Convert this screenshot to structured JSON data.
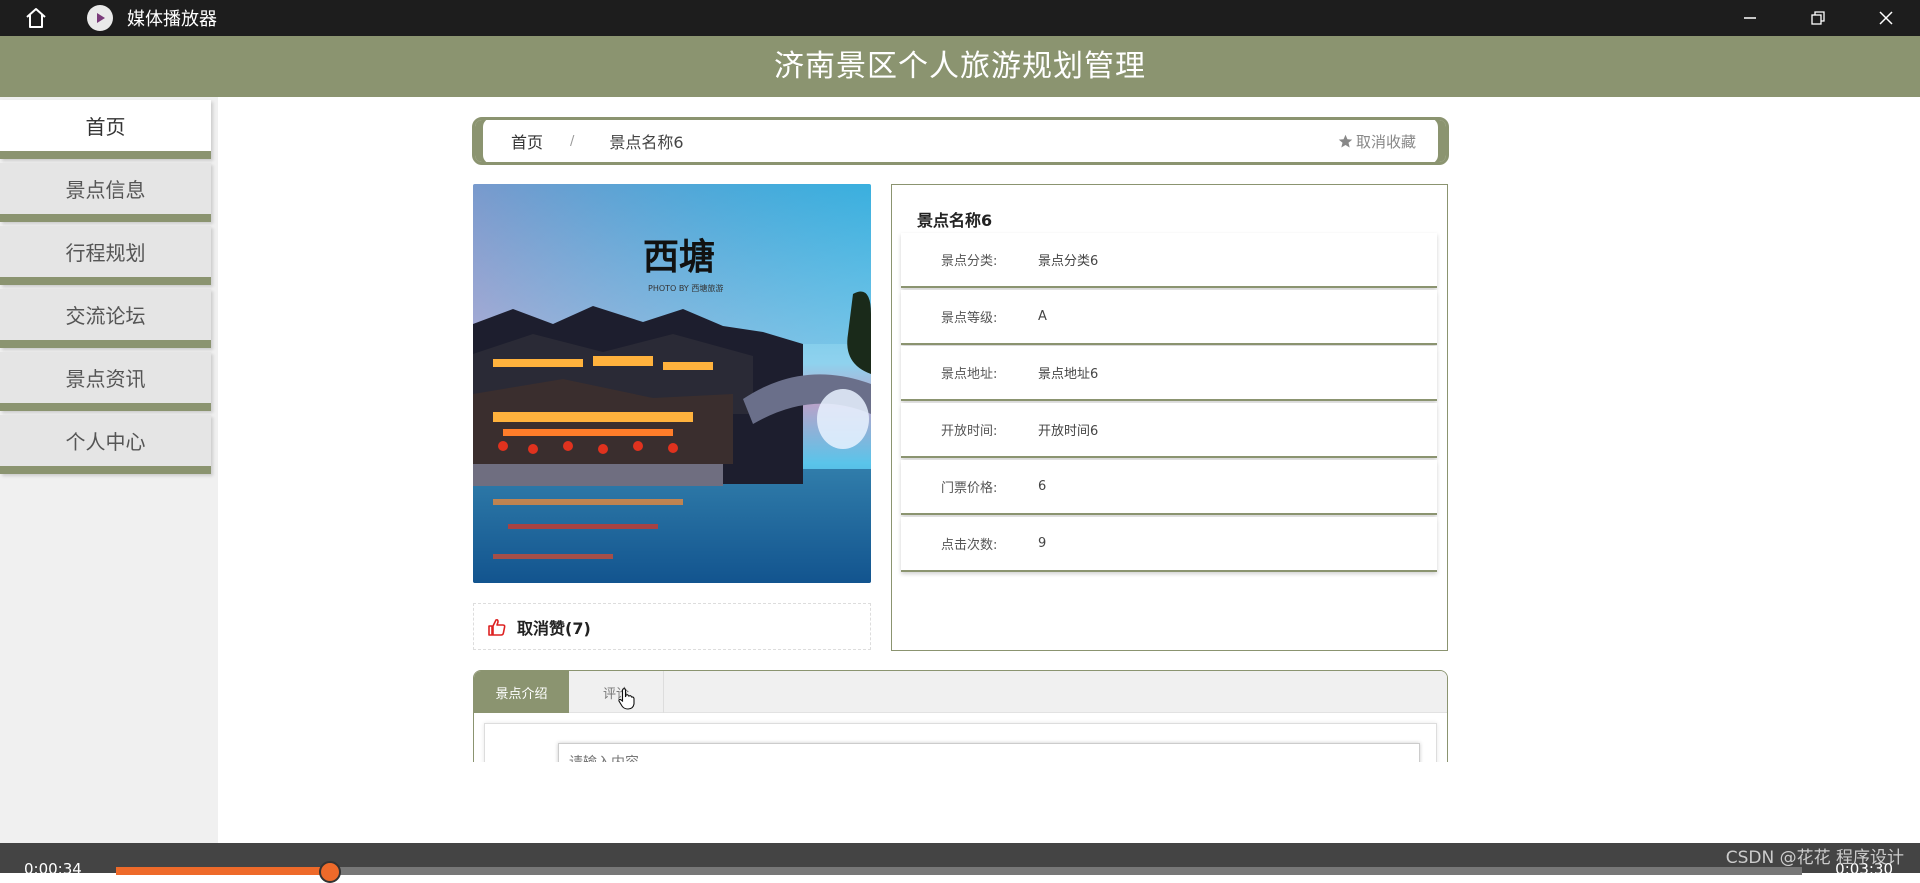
{
  "player": {
    "title": "媒体播放器",
    "current_time": "0:00:34",
    "total_time": "0:03:30",
    "progress": 0.127,
    "watermark": "CSDN @花花 程序设计"
  },
  "site": {
    "title": "济南景区个人旅游规划管理"
  },
  "sidebar": {
    "items": [
      {
        "label": "首页"
      },
      {
        "label": "景点信息"
      },
      {
        "label": "行程规划"
      },
      {
        "label": "交流论坛"
      },
      {
        "label": "景点资讯"
      },
      {
        "label": "个人中心"
      }
    ]
  },
  "breadcrumb": {
    "home": "首页",
    "separator": "/",
    "current": "景点名称6",
    "favorite": "取消收藏"
  },
  "image": {
    "caption_line1": "西塘",
    "caption_line2": "PHOTO BY 西塘旅游"
  },
  "like": {
    "label": "取消赞(7)"
  },
  "info": {
    "title": "景点名称6",
    "rows": [
      {
        "label": "景点分类:",
        "value": "景点分类6"
      },
      {
        "label": "景点等级:",
        "value": "A"
      },
      {
        "label": "景点地址:",
        "value": "景点地址6"
      },
      {
        "label": "开放时间:",
        "value": "开放时间6"
      },
      {
        "label": "门票价格:",
        "value": "6"
      },
      {
        "label": "点击次数:",
        "value": "9"
      }
    ]
  },
  "tabs": {
    "intro": "景点介绍",
    "comment": "评论",
    "comment_placeholder": "请输入内容"
  },
  "colors": {
    "accent": "#8b9470",
    "progress": "#ee6a2a",
    "titlebar": "#1d1d1d"
  }
}
